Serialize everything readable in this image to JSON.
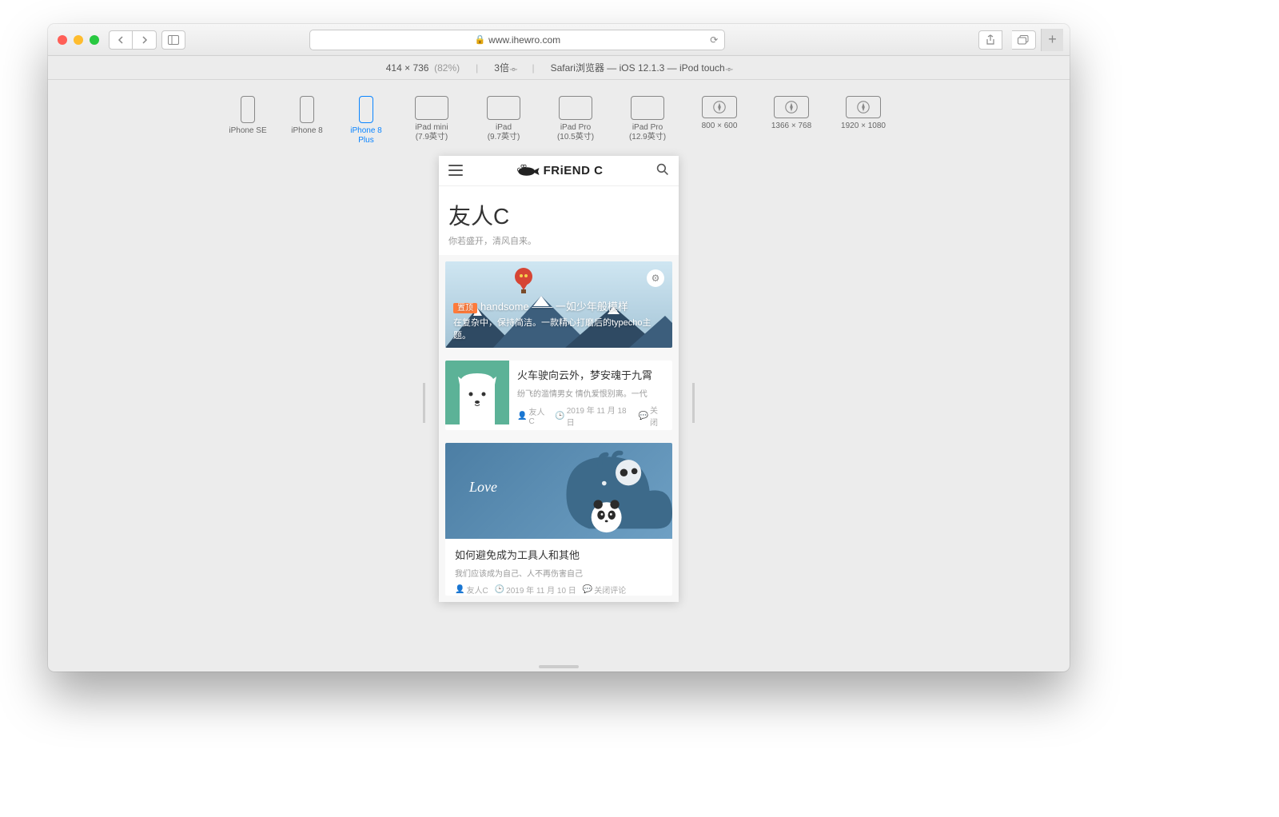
{
  "browser": {
    "url_display": "www.ihewro.com",
    "responsive": {
      "size_label": "414 × 736",
      "zoom_label": "(82%)",
      "pixel_ratio": "3倍",
      "ua_label": "Safari浏览器 — iOS 12.1.3 — iPod touch"
    },
    "devices": [
      {
        "label": "iPhone SE",
        "kind": "phone",
        "active": false
      },
      {
        "label": "iPhone 8",
        "kind": "phone",
        "active": false
      },
      {
        "label": "iPhone 8 Plus",
        "kind": "phone",
        "active": true
      },
      {
        "label": "iPad mini\n(7.9英寸)",
        "kind": "tablet",
        "active": false
      },
      {
        "label": "iPad\n(9.7英寸)",
        "kind": "tablet",
        "active": false
      },
      {
        "label": "iPad Pro\n(10.5英寸)",
        "kind": "tablet",
        "active": false
      },
      {
        "label": "iPad Pro\n(12.9英寸)",
        "kind": "tablet",
        "active": false
      },
      {
        "label": "800 × 600",
        "kind": "desktop",
        "active": false
      },
      {
        "label": "1366 × 768",
        "kind": "desktop",
        "active": false
      },
      {
        "label": "1920 × 1080",
        "kind": "desktop",
        "active": false
      }
    ]
  },
  "page": {
    "logo_text": "FRiEND C",
    "hero_title": "友人C",
    "hero_subtitle": "你若盛开，清风自来。",
    "featured": {
      "badge": "置顶",
      "title": "handsome —— 一如少年般模样",
      "subtitle": "在复杂中，保持简洁。一款精心打磨后的typecho主题。"
    },
    "post1": {
      "title": "火车驶向云外，梦安魂于九霄",
      "excerpt": "纷飞的滥情男女 情仇爱恨别离。一代",
      "author": "友人C",
      "date": "2019 年 11 月 18 日",
      "comments": "关闭"
    },
    "post2": {
      "love": "Love",
      "title": "如何避免成为工具人和其他",
      "excerpt": "我们应该成为自己、人不再伤害自己",
      "author": "友人C",
      "date": "2019 年 11 月 10 日",
      "comments": "关闭评论"
    }
  }
}
